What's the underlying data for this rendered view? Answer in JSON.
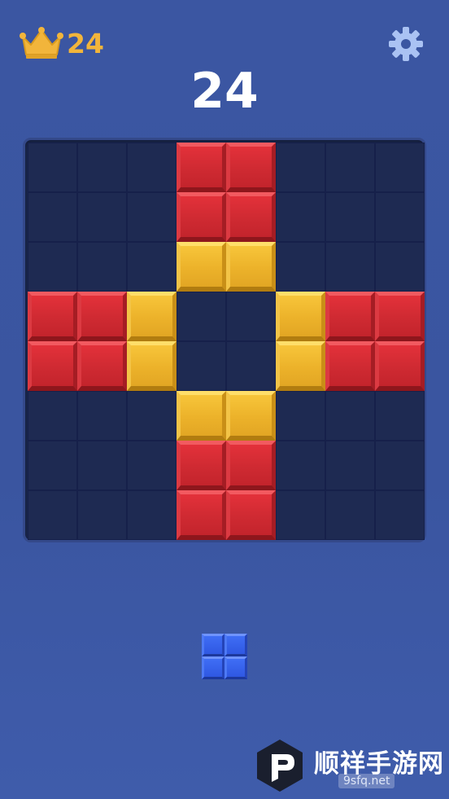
{
  "header": {
    "best_score": "24",
    "best_icon": "crown-icon",
    "settings_icon": "gear-icon",
    "current_score": "24"
  },
  "board": {
    "size": 8,
    "rows": [
      [
        "",
        "",
        "",
        "R",
        "R",
        "",
        "",
        ""
      ],
      [
        "",
        "",
        "",
        "R",
        "R",
        "",
        "",
        ""
      ],
      [
        "",
        "",
        "",
        "Y",
        "Y",
        "",
        "",
        ""
      ],
      [
        "R",
        "R",
        "Y",
        "",
        "",
        "Y",
        "R",
        "R"
      ],
      [
        "R",
        "R",
        "Y",
        "",
        "",
        "Y",
        "R",
        "R"
      ],
      [
        "",
        "",
        "",
        "Y",
        "Y",
        "",
        "",
        ""
      ],
      [
        "",
        "",
        "",
        "R",
        "R",
        "",
        "",
        ""
      ],
      [
        "",
        "",
        "",
        "R",
        "R",
        "",
        "",
        ""
      ]
    ],
    "legend": {
      "R": "red",
      "Y": "yellow"
    }
  },
  "next_piece": {
    "color": "blue",
    "cells": [
      [
        1,
        1
      ],
      [
        1,
        1
      ]
    ]
  },
  "colors": {
    "background": "#3b56a2",
    "best_score": "#f2b53b",
    "board": "#1b2850",
    "red_block": "#d82d35",
    "yellow_block": "#efb52c",
    "blue_block": "#3360ea"
  },
  "watermark": {
    "title": "顺祥手游网",
    "site": "9sfq.net"
  }
}
